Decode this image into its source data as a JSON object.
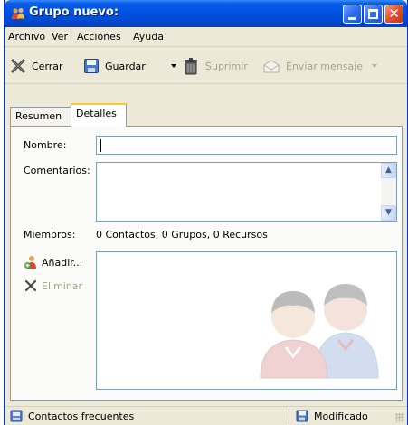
{
  "window": {
    "title": "Grupo nuevo:",
    "controls": [
      "minimize",
      "maximize",
      "close"
    ]
  },
  "menu": {
    "items": [
      {
        "label": "Archivo"
      },
      {
        "label": "Ver"
      },
      {
        "label": "Acciones"
      },
      {
        "label": "Ayuda"
      }
    ]
  },
  "toolbar": {
    "close_label": "Cerrar",
    "save_label": "Guardar",
    "delete_label": "Suprimir",
    "send_label": "Enviar mensaje"
  },
  "tabs": [
    {
      "label": "Resumen",
      "active": false
    },
    {
      "label": "Detalles",
      "active": true
    }
  ],
  "form": {
    "name_label": "Nombre:",
    "name_value": "",
    "comments_label": "Comentarios:",
    "comments_value": "",
    "members_label": "Miembros:",
    "members_summary": "0 Contactos, 0 Grupos, 0 Recursos",
    "add_label": "Añadir...",
    "remove_label": "Eliminar"
  },
  "status": {
    "left_text": "Contactos frecuentes",
    "right_text": "Modificado"
  },
  "icons": {
    "title": "group-icon",
    "close": "close-x-icon",
    "save": "floppy-disk-icon",
    "delete": "trash-can-icon",
    "send": "envelope-icon",
    "add": "add-person-icon",
    "remove": "remove-x-icon",
    "watermark": "group-people-icon",
    "status_left": "address-book-icon",
    "status_right": "floppy-disk-icon"
  },
  "colors": {
    "titlebar": "#0054E3",
    "window_bg": "#ECE9D8",
    "active_tab_accent": "#FFC83C",
    "field_border": "#7F9DB9",
    "disabled_text": "#A7A38E"
  }
}
